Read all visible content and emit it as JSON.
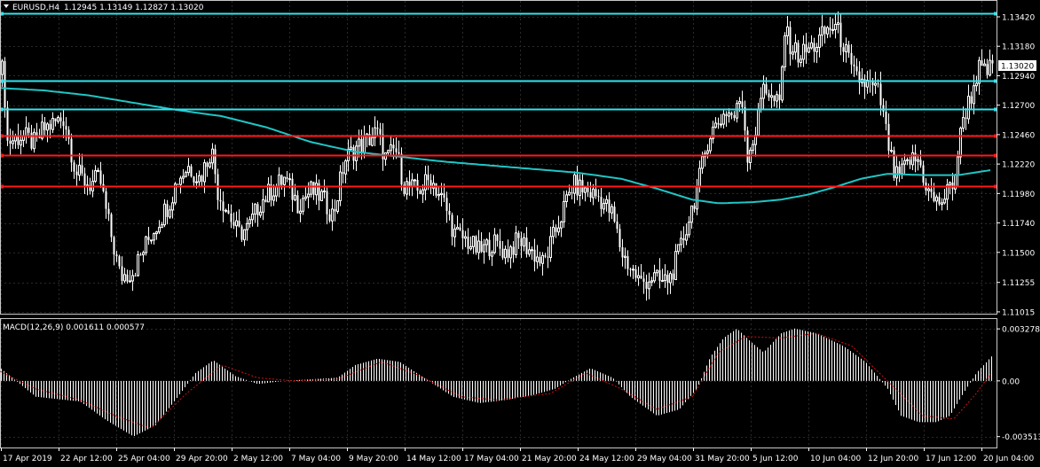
{
  "header": {
    "symbol_label": "EURUSD,H4",
    "ohlc_label": "1.12945 1.13149 1.12827 1.13020"
  },
  "macd_header": {
    "label": "MACD(12,26,9) 0.001611 0.000577"
  },
  "colors": {
    "background": "#000000",
    "grid": "#2a2a2a",
    "candle": "#ffffff",
    "ma": "#20c5c5",
    "cyan_line": "#2ee6ee",
    "red_line": "#ff1818",
    "macd_hist": "#ffffff",
    "macd_signal": "#d01010",
    "axis_text": "#ffffff"
  },
  "chart_data": [
    {
      "type": "candlestick",
      "title": "EURUSD,H4",
      "ylim": [
        1.11,
        1.1355
      ],
      "y_ticks": [
        "1.13420",
        "1.13180",
        "1.12940",
        "1.12700",
        "1.12460",
        "1.12220",
        "1.11980",
        "1.11740",
        "1.11500",
        "1.11255",
        "1.11015"
      ],
      "current_price": "1.13020",
      "x_tick_labels": [
        "17 Apr 2019",
        "22 Apr 12:00",
        "25 Apr 04:00",
        "29 Apr 20:00",
        "2 May 12:00",
        "7 May 04:00",
        "9 May 20:00",
        "14 May 12:00",
        "17 May 04:00",
        "21 May 20:00",
        "24 May 12:00",
        "29 May 04:00",
        "31 May 20:00",
        "5 Jun 12:00",
        "10 Jun 04:00",
        "12 Jun 20:00",
        "17 Jun 12:00",
        "20 Jun 04:00"
      ],
      "close_path_anchors": [
        [
          0,
          1.1295
        ],
        [
          3,
          1.13
        ],
        [
          8,
          1.124
        ],
        [
          25,
          1.1245
        ],
        [
          40,
          1.1238
        ],
        [
          48,
          1.125
        ],
        [
          60,
          1.1255
        ],
        [
          72,
          1.126
        ],
        [
          85,
          1.1215
        ],
        [
          100,
          1.1205
        ],
        [
          112,
          1.121
        ],
        [
          120,
          1.118
        ],
        [
          135,
          1.113
        ],
        [
          150,
          1.1135
        ],
        [
          170,
          1.1165
        ],
        [
          190,
          1.119
        ],
        [
          200,
          1.121
        ],
        [
          212,
          1.122
        ],
        [
          225,
          1.121
        ],
        [
          238,
          1.1235
        ],
        [
          245,
          1.12
        ],
        [
          255,
          1.1185
        ],
        [
          268,
          1.1165
        ],
        [
          280,
          1.117
        ],
        [
          292,
          1.119
        ],
        [
          305,
          1.12
        ],
        [
          320,
          1.121
        ],
        [
          335,
          1.119
        ],
        [
          350,
          1.12
        ],
        [
          362,
          1.1195
        ],
        [
          375,
          1.118
        ],
        [
          388,
          1.1225
        ],
        [
          400,
          1.1235
        ],
        [
          412,
          1.124
        ],
        [
          424,
          1.1248
        ],
        [
          435,
          1.1225
        ],
        [
          445,
          1.1235
        ],
        [
          455,
          1.1205
        ],
        [
          470,
          1.12
        ],
        [
          485,
          1.121
        ],
        [
          500,
          1.119
        ],
        [
          512,
          1.1165
        ],
        [
          525,
          1.116
        ],
        [
          540,
          1.115
        ],
        [
          555,
          1.1158
        ],
        [
          570,
          1.115
        ],
        [
          585,
          1.116
        ],
        [
          600,
          1.115
        ],
        [
          612,
          1.114
        ],
        [
          622,
          1.116
        ],
        [
          632,
          1.118
        ],
        [
          645,
          1.1205
        ],
        [
          660,
          1.12
        ],
        [
          675,
          1.1195
        ],
        [
          690,
          1.118
        ],
        [
          700,
          1.115
        ],
        [
          712,
          1.1135
        ],
        [
          722,
          1.1125
        ],
        [
          735,
          1.113
        ],
        [
          745,
          1.1125
        ],
        [
          755,
          1.113
        ],
        [
          765,
          1.115
        ],
        [
          775,
          1.1175
        ],
        [
          788,
          1.121
        ],
        [
          798,
          1.1245
        ],
        [
          808,
          1.1255
        ],
        [
          818,
          1.1265
        ],
        [
          828,
          1.126
        ],
        [
          835,
          1.128
        ],
        [
          842,
          1.123
        ],
        [
          852,
          1.125
        ],
        [
          860,
          1.129
        ],
        [
          868,
          1.1275
        ],
        [
          878,
          1.127
        ],
        [
          884,
          1.133
        ],
        [
          890,
          1.132
        ],
        [
          900,
          1.131
        ],
        [
          910,
          1.1315
        ],
        [
          920,
          1.132
        ],
        [
          930,
          1.133
        ],
        [
          940,
          1.1335
        ],
        [
          950,
          1.132
        ],
        [
          960,
          1.1295
        ],
        [
          970,
          1.129
        ],
        [
          980,
          1.1285
        ],
        [
          990,
          1.128
        ],
        [
          1000,
          1.124
        ],
        [
          1008,
          1.121
        ],
        [
          1016,
          1.1215
        ],
        [
          1025,
          1.1225
        ],
        [
          1035,
          1.1225
        ],
        [
          1045,
          1.12
        ],
        [
          1055,
          1.119
        ],
        [
          1065,
          1.1195
        ],
        [
          1075,
          1.121
        ],
        [
          1085,
          1.126
        ],
        [
          1095,
          1.128
        ],
        [
          1102,
          1.13
        ],
        [
          1110,
          1.1295
        ],
        [
          1118,
          1.1302
        ]
      ],
      "moving_average": [
        [
          0,
          1.1284
        ],
        [
          50,
          1.1282
        ],
        [
          100,
          1.1278
        ],
        [
          150,
          1.1272
        ],
        [
          200,
          1.1266
        ],
        [
          250,
          1.1261
        ],
        [
          300,
          1.1252
        ],
        [
          350,
          1.124
        ],
        [
          400,
          1.1232
        ],
        [
          450,
          1.1228
        ],
        [
          500,
          1.1224
        ],
        [
          550,
          1.1221
        ],
        [
          600,
          1.1218
        ],
        [
          650,
          1.1215
        ],
        [
          700,
          1.121
        ],
        [
          740,
          1.1202
        ],
        [
          780,
          1.1193
        ],
        [
          810,
          1.119
        ],
        [
          850,
          1.1191
        ],
        [
          880,
          1.1193
        ],
        [
          910,
          1.1197
        ],
        [
          940,
          1.1203
        ],
        [
          970,
          1.121
        ],
        [
          1000,
          1.1214
        ],
        [
          1040,
          1.1213
        ],
        [
          1080,
          1.1213
        ],
        [
          1116,
          1.1217
        ]
      ],
      "horizontal_lines": [
        {
          "price": 1.1345,
          "color": "cyan"
        },
        {
          "price": 1.129,
          "color": "cyan"
        },
        {
          "price": 1.1267,
          "color": "cyan"
        },
        {
          "price": 1.1245,
          "color": "red"
        },
        {
          "price": 1.1229,
          "color": "red"
        },
        {
          "price": 1.1204,
          "color": "red"
        }
      ]
    },
    {
      "type": "macd",
      "title": "MACD(12,26,9) 0.001611 0.000577",
      "ylim": [
        -0.0042,
        0.0039
      ],
      "y_ticks": [
        "0.003278",
        "0.00",
        "-0.003513"
      ],
      "macd_anchors": [
        [
          0,
          0.0008
        ],
        [
          40,
          -0.001
        ],
        [
          90,
          -0.0013
        ],
        [
          120,
          -0.0025
        ],
        [
          150,
          -0.0035
        ],
        [
          175,
          -0.0028
        ],
        [
          200,
          -0.001
        ],
        [
          220,
          0.0005
        ],
        [
          240,
          0.0013
        ],
        [
          265,
          0.0003
        ],
        [
          290,
          -0.0002
        ],
        [
          320,
          0.0
        ],
        [
          350,
          0.0001
        ],
        [
          380,
          0.0002
        ],
        [
          400,
          0.001
        ],
        [
          425,
          0.0014
        ],
        [
          450,
          0.0012
        ],
        [
          480,
          0.0001
        ],
        [
          510,
          -0.001
        ],
        [
          540,
          -0.0014
        ],
        [
          570,
          -0.0012
        ],
        [
          600,
          -0.0009
        ],
        [
          625,
          -0.0005
        ],
        [
          645,
          0.0002
        ],
        [
          665,
          0.0008
        ],
        [
          690,
          0.0002
        ],
        [
          710,
          -0.001
        ],
        [
          740,
          -0.0022
        ],
        [
          765,
          -0.0018
        ],
        [
          785,
          -0.0005
        ],
        [
          800,
          0.0015
        ],
        [
          815,
          0.0027
        ],
        [
          830,
          0.0033
        ],
        [
          845,
          0.0025
        ],
        [
          860,
          0.0018
        ],
        [
          880,
          0.003
        ],
        [
          895,
          0.0033
        ],
        [
          920,
          0.003
        ],
        [
          950,
          0.0022
        ],
        [
          975,
          0.0012
        ],
        [
          1000,
          -0.0005
        ],
        [
          1015,
          -0.0022
        ],
        [
          1035,
          -0.0026
        ],
        [
          1055,
          -0.0026
        ],
        [
          1070,
          -0.0022
        ],
        [
          1085,
          -0.0008
        ],
        [
          1100,
          0.0005
        ],
        [
          1118,
          0.0016
        ]
      ],
      "signal_anchors": [
        [
          0,
          0.0006
        ],
        [
          40,
          -0.0005
        ],
        [
          90,
          -0.0012
        ],
        [
          130,
          -0.0022
        ],
        [
          170,
          -0.003
        ],
        [
          210,
          -0.0008
        ],
        [
          250,
          0.001
        ],
        [
          290,
          0.0002
        ],
        [
          330,
          0.0
        ],
        [
          380,
          0.0001
        ],
        [
          430,
          0.0012
        ],
        [
          470,
          0.0004
        ],
        [
          520,
          -0.001
        ],
        [
          560,
          -0.0012
        ],
        [
          620,
          -0.0008
        ],
        [
          660,
          0.0005
        ],
        [
          700,
          -0.0005
        ],
        [
          740,
          -0.0018
        ],
        [
          780,
          -0.001
        ],
        [
          810,
          0.0018
        ],
        [
          840,
          0.0028
        ],
        [
          880,
          0.0027
        ],
        [
          920,
          0.003
        ],
        [
          960,
          0.0022
        ],
        [
          1000,
          0.0
        ],
        [
          1040,
          -0.0022
        ],
        [
          1075,
          -0.0024
        ],
        [
          1100,
          -0.0008
        ],
        [
          1118,
          0.0006
        ]
      ]
    }
  ]
}
